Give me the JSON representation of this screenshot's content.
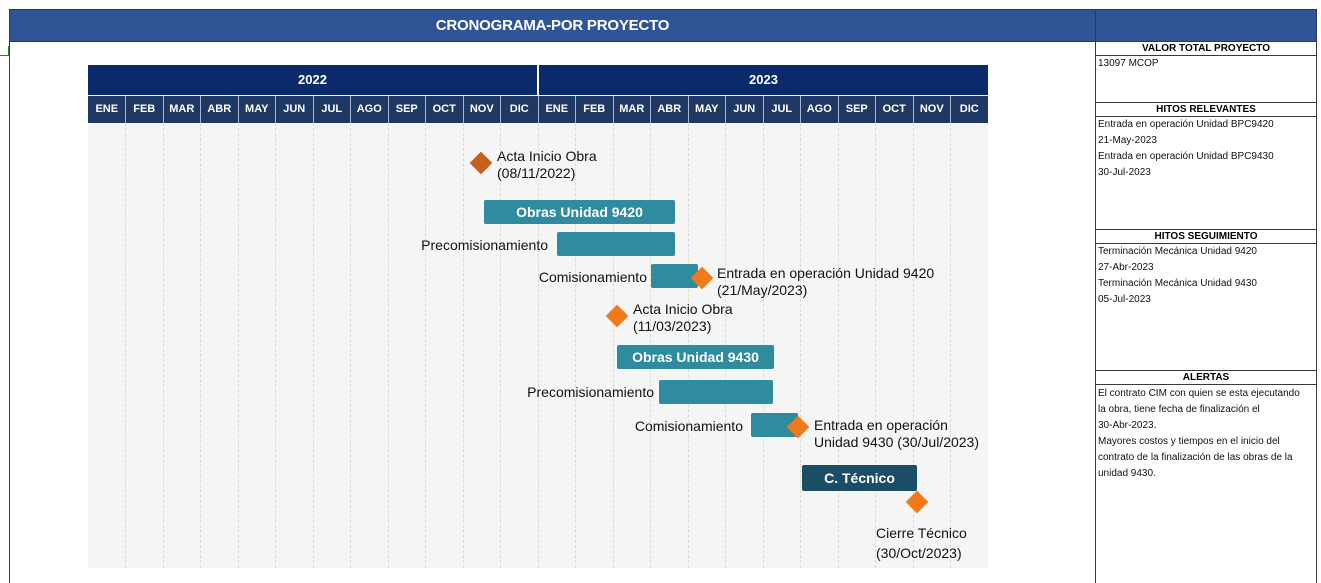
{
  "title": "CRONOGRAMA-POR PROYECTO",
  "timeline": {
    "years": [
      "2022",
      "2023"
    ],
    "months": [
      "ENE",
      "FEB",
      "MAR",
      "ABR",
      "MAY",
      "JUN",
      "JUL",
      "AGO",
      "SEP",
      "OCT",
      "NOV",
      "DIC",
      "ENE",
      "FEB",
      "MAR",
      "ABR",
      "MAY",
      "JUN",
      "JUL",
      "AGO",
      "SEP",
      "OCT",
      "NOV",
      "DIC"
    ]
  },
  "gantt": {
    "bars": {
      "obras_9420": "Obras Unidad 9420",
      "obras_9430": "Obras Unidad 9430",
      "c_tecnico": "C. Técnico"
    },
    "labels": {
      "acta_1_line1": "Acta Inicio Obra",
      "acta_1_line2": "(08/11/2022)",
      "precom_1": "Precomisionamiento",
      "comis_1": "Comisionamiento",
      "entrada_1_line1": "Entrada en operación Unidad 9420",
      "entrada_1_line2": "(21/May/2023)",
      "acta_2_line1": "Acta Inicio Obra",
      "acta_2_line2": "(11/03/2023)",
      "precom_2": "Precomisionamiento",
      "comis_2": "Comisionamiento",
      "entrada_2_line1": "Entrada en operación",
      "entrada_2_line2": "Unidad 9430 (30/Jul/2023)",
      "cierre_line1": "Cierre Técnico",
      "cierre_line2": "(30/Oct/2023)"
    },
    "colors": {
      "bar": "#2e8ba0",
      "bar_dark": "#1b4e66",
      "milestone": "#f07a1a",
      "header": "#1f3864"
    }
  },
  "panel": {
    "valor_title": "VALOR TOTAL PROYECTO",
    "valor": "13097  MCOP",
    "hitos_rel_title": "HITOS RELEVANTES",
    "hitos_rel": [
      "Entrada en operación Unidad BPC9420",
      "21-May-2023",
      "Entrada en operación Unidad BPC9430",
      "30-Jul-2023"
    ],
    "hitos_seg_title": "HITOS SEGUIMIENTO",
    "hitos_seg": [
      "Terminación Mecánica Unidad 9420",
      "27-Abr-2023",
      "Terminación Mecánica Unidad 9430",
      "05-Jul-2023"
    ],
    "alertas_title": "ALERTAS",
    "alertas": [
      "El contrato CIM con quien se esta ejecutando",
      "la obra, tiene fecha de finalización el",
      "30-Abr-2023.",
      "Mayores costos y tiempos en el inicio del",
      "contrato de la finalización de las obras de la",
      "unidad 9430."
    ]
  }
}
